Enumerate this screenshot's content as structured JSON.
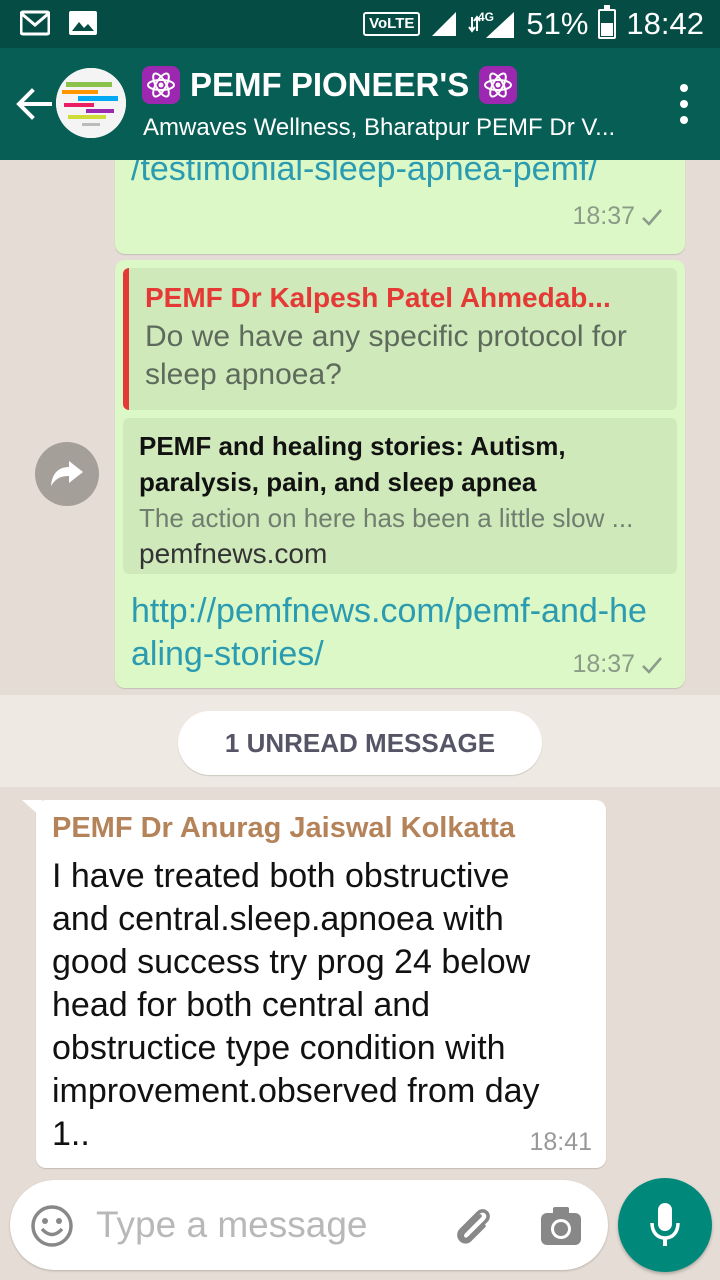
{
  "status_bar": {
    "volte": "VoLTE",
    "network": "4G",
    "battery": "51%",
    "battery_level": 0.51,
    "time": "18:42",
    "icons": [
      "gmail-icon",
      "gallery-icon",
      "signal-icon",
      "data-icon",
      "battery-icon"
    ]
  },
  "header": {
    "title": "PEMF PIONEER'S",
    "subtitle": "Amwaves Wellness, Bharatpur PEMF Dr V...",
    "title_emoji": "⚛"
  },
  "messages": {
    "m1": {
      "link_fragment": "/testimonial-sleep-apnea-pemf/",
      "time": "18:37"
    },
    "m2": {
      "quote_author": "PEMF Dr Kalpesh Patel Ahmedab...",
      "quote_text": "Do we have any specific protocol for sleep apnoea?",
      "preview_title": "PEMF and healing stories: Autism, paralysis, pain, and sleep apnea",
      "preview_desc": "The action on here has been a little slow ...",
      "preview_domain": "pemfnews.com",
      "link": "http://pemfnews.com/pemf-and-healing-stories/",
      "time": "18:37"
    },
    "unread": "1 UNREAD MESSAGE",
    "m3": {
      "sender": "PEMF Dr Anurag Jaiswal Kolkatta",
      "text": "I have treated both obstructive and central.sleep.apnoea with good success try prog 24 below head for both central and obstructice type condition with improvement.observed from day 1..",
      "time": "18:41"
    }
  },
  "input": {
    "placeholder": "Type a message"
  },
  "colors": {
    "header": "#075e54",
    "status_bar": "#054d44",
    "outgoing_bubble": "#dcf8c6",
    "link": "#2a9bb1",
    "quote_author": "#e53935",
    "sender_name": "#b5835a",
    "mic_button": "#00897b"
  }
}
